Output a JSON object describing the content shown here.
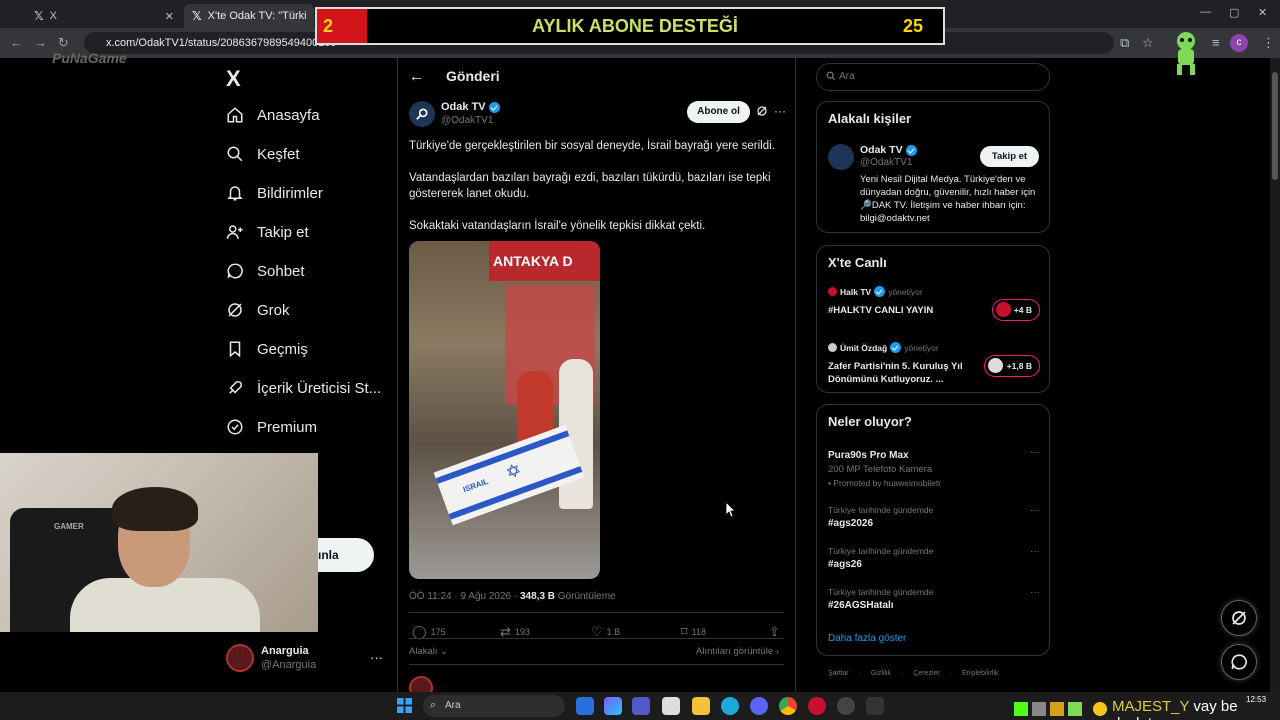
{
  "browser": {
    "tabs": [
      {
        "label": "X",
        "active": false
      },
      {
        "label": "X'te Odak TV: \"Türkiye'de g",
        "active": true
      }
    ],
    "url": "x.com/OdakTV1/status/2086367989549400159",
    "profile_letter": "c"
  },
  "stream": {
    "banner_left": "2",
    "banner_title": "AYLIK ABONE DESTEĞİ",
    "banner_right": "25",
    "logo": "PuNaGame"
  },
  "nav": {
    "brand": "X",
    "items": [
      {
        "label": "Anasayfa",
        "icon": "home-icon"
      },
      {
        "label": "Keşfet",
        "icon": "search-icon"
      },
      {
        "label": "Bildirimler",
        "icon": "bell-icon"
      },
      {
        "label": "Takip et",
        "icon": "add-user-icon"
      },
      {
        "label": "Sohbet",
        "icon": "chat-icon"
      },
      {
        "label": "Grok",
        "icon": "grok-icon"
      },
      {
        "label": "Geçmiş",
        "icon": "bookmark-icon"
      },
      {
        "label": "İçerik Üreticisi St...",
        "icon": "rocket-icon"
      },
      {
        "label": "Premium",
        "icon": "verified-icon"
      }
    ],
    "post_button": "ınla",
    "profile_name": "Anarguia",
    "profile_handle": "@Anarguia"
  },
  "post": {
    "header": "Gönderi",
    "author_name": "Odak TV",
    "author_handle": "@OdakTV1",
    "subscribe": "Abone ol",
    "paragraphs": [
      "Türkiye'de gerçekleştirilen bir sosyal deneyde, İsrail bayrağı yere serildi.",
      "Vatandaşlardan bazıları bayrağı ezdi, bazıları tükürdü, bazıları ise tepki göstererek lanet okudu.",
      "Sokaktaki vatandaşların İsrail'e yönelik tepkisi dikkat çekti."
    ],
    "media_sign": "ANTAKYA D",
    "media_flag_text": "ISRAIL",
    "time": "ÖÖ 11:24 · 9 Ağu 2026 · ",
    "views_value": "348,3 B",
    "views_label": " Görüntüleme",
    "stats": {
      "replies": "175",
      "reposts": "193",
      "likes": "1 B",
      "bookmarks": "118"
    },
    "reply_sort": "Alakalı",
    "quotes_link": "Alıntıları görüntüle"
  },
  "sidebar": {
    "search_placeholder": "Ara",
    "related": {
      "title": "Alakalı kişiler",
      "name": "Odak TV",
      "handle": "@OdakTV1",
      "follow": "Takip et",
      "bio": "Yeni Nesil Dijital Medya. Türkiye'den ve dünyadan doğru, güvenilir, hızlı haber için 🔎DAK TV. İletişim ve haber ihbarı için: bilgi@odaktv.net"
    },
    "live": {
      "title": "X'te Canlı",
      "items": [
        {
          "host": "Halk TV",
          "role": "yönetiyor",
          "title": "#HALKTV CANLI YAYIN",
          "count": "+4 B"
        },
        {
          "host": "Ümit Özdağ",
          "role": "yönetiyor",
          "title": "Zafer Partisi'nin 5. Kuruluş Yıl Dönümünü Kutluyoruz. ...",
          "count": "+1,8 B"
        }
      ]
    },
    "trends": {
      "title": "Neler oluyor?",
      "promoted": {
        "title": "Pura90s Pro Max",
        "sub": "200 MP Telefoto Kamera",
        "promo": "Promoted by huaweimobiletr"
      },
      "items": [
        {
          "context": "Türkiye tarihinde gündemde",
          "tag": "#ags2026"
        },
        {
          "context": "Türkiye tarihinde gündemde",
          "tag": "#ags26"
        },
        {
          "context": "Türkiye tarihinde gündemde",
          "tag": "#26AGSHatalı"
        }
      ],
      "show_more": "Daha fazla göster"
    },
    "footer": "Şartlar · Gizlilik · Çerezler · Erişilebilirlik"
  },
  "webcam": {
    "chair_label": "GAMER"
  },
  "taskbar": {
    "search": "Ara",
    "overlay_name": "MAJEST_Y",
    "overlay_msg": "vay be devlet",
    "time": "12:53"
  },
  "colors": {
    "accent": "#1d9bf0",
    "banner_red": "#d4141b",
    "banner_text": "#c9e265",
    "live_ring": "#f91880"
  }
}
